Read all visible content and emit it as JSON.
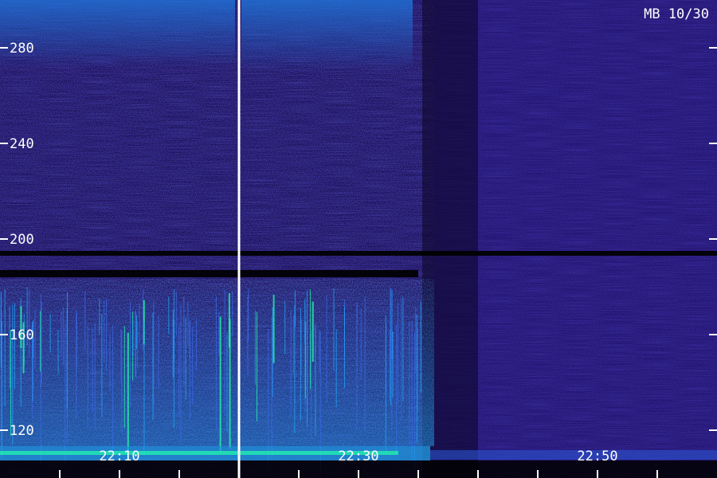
{
  "chart_data": {
    "type": "heatmap",
    "title": "MB 10/30",
    "xlabel": "",
    "ylabel": "",
    "x_range": [
      "22:00",
      "23:00"
    ],
    "y_range": [
      100,
      300
    ],
    "x_tick_labels": [
      "22:10",
      "22:30",
      "22:50"
    ],
    "y_tick_labels": [
      120,
      160,
      200,
      240,
      280
    ],
    "y_right_ticks": [
      120,
      160,
      200,
      240,
      280
    ],
    "x_minor_ticks_minutes": [
      5,
      10,
      15,
      20,
      25,
      30,
      35,
      40,
      45,
      50,
      55
    ],
    "marker_time": "22:20",
    "transition_time": "22:36",
    "dark_bands": [
      {
        "y_start": 184,
        "y_end": 187,
        "time_start": "22:00",
        "time_end": "22:35"
      },
      {
        "y_start": 193,
        "y_end": 195,
        "time_start": "22:00",
        "time_end": "23:00"
      }
    ],
    "colors": {
      "background": "#000000",
      "low": "#1a0a4a",
      "mid": "#2a28c8",
      "high": "#1ea8ff",
      "peak": "#22ffaa",
      "text": "#ffffff"
    }
  }
}
